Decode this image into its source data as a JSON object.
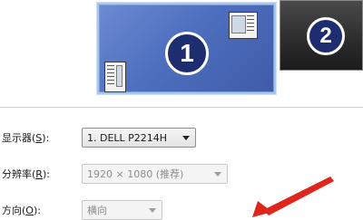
{
  "preview": {
    "monitor1_number": "1",
    "monitor2_number": "2"
  },
  "settings": {
    "display": {
      "label_prefix": "显示器(",
      "label_key": "S",
      "label_suffix": "):",
      "value": "1. DELL P2214H"
    },
    "resolution": {
      "label_prefix": "分辨率(",
      "label_key": "R",
      "label_suffix": "):",
      "value": "1920 × 1080 (推荐)"
    },
    "orientation": {
      "label_prefix": "方向(",
      "label_key": "O",
      "label_suffix": "):",
      "value": "横向"
    }
  },
  "colors": {
    "monitor1_fill": "#4e6fbf",
    "monitor2_fill": "#2b2b2b",
    "arrow": "#e0261c"
  }
}
